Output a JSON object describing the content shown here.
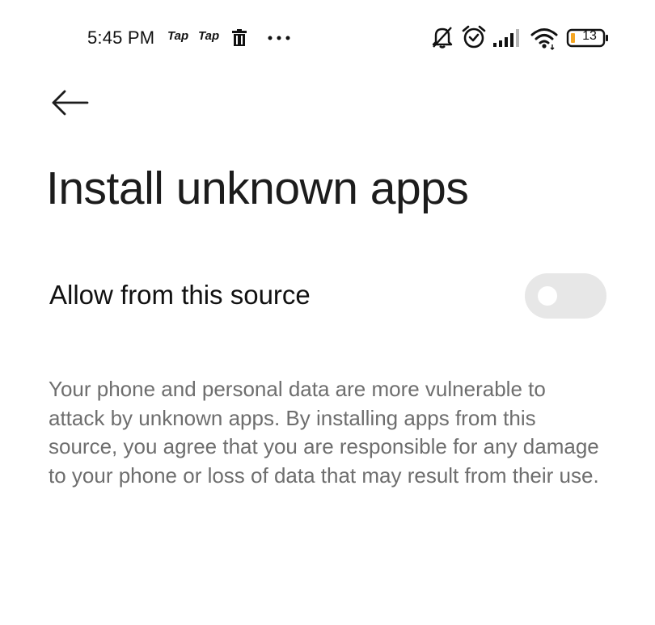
{
  "status_bar": {
    "time": "5:45 PM",
    "notification_apps": [
      "Tap",
      "Tap"
    ],
    "icons": [
      "trash-icon",
      "more-icon",
      "mute-icon",
      "alarm-icon",
      "signal-icon",
      "wifi-icon",
      "battery-icon"
    ],
    "battery_level": "13",
    "battery_color": "#f5a623"
  },
  "header": {
    "back_icon": "arrow-left-icon"
  },
  "page": {
    "title": "Install unknown apps"
  },
  "setting": {
    "label": "Allow from this source",
    "enabled": false,
    "toggle_track_color": "#e7e7e7"
  },
  "description": "Your phone and personal data are more vulnerable to attack by unknown apps. By installing apps from this source, you agree that you are responsible for any damage to your phone or loss of data that may result from their use."
}
